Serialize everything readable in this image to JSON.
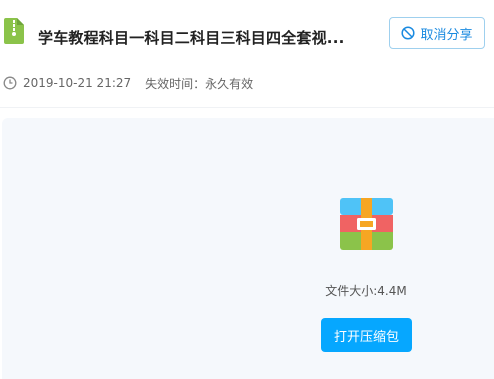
{
  "header": {
    "title": "学车教程科目一科目二科目三科目四全套视...",
    "file_icon": "green-document-icon",
    "cancel_share_label": "取消分享",
    "cancel_share_icon": "ban-icon"
  },
  "meta": {
    "clock_icon": "clock-icon",
    "share_time": "2019-10-21 21:27",
    "expire_label": "失效时间：永久有效"
  },
  "preview": {
    "file_type_icon": "zip-archive-icon",
    "file_size_label": "文件大小:4.4M",
    "open_button_label": "打开压缩包"
  },
  "colors": {
    "accent": "#06a7ff",
    "cancel_text": "#1a8ae0",
    "preview_bg": "#f5f8fc",
    "file_icon_green": "#8bc34a"
  }
}
